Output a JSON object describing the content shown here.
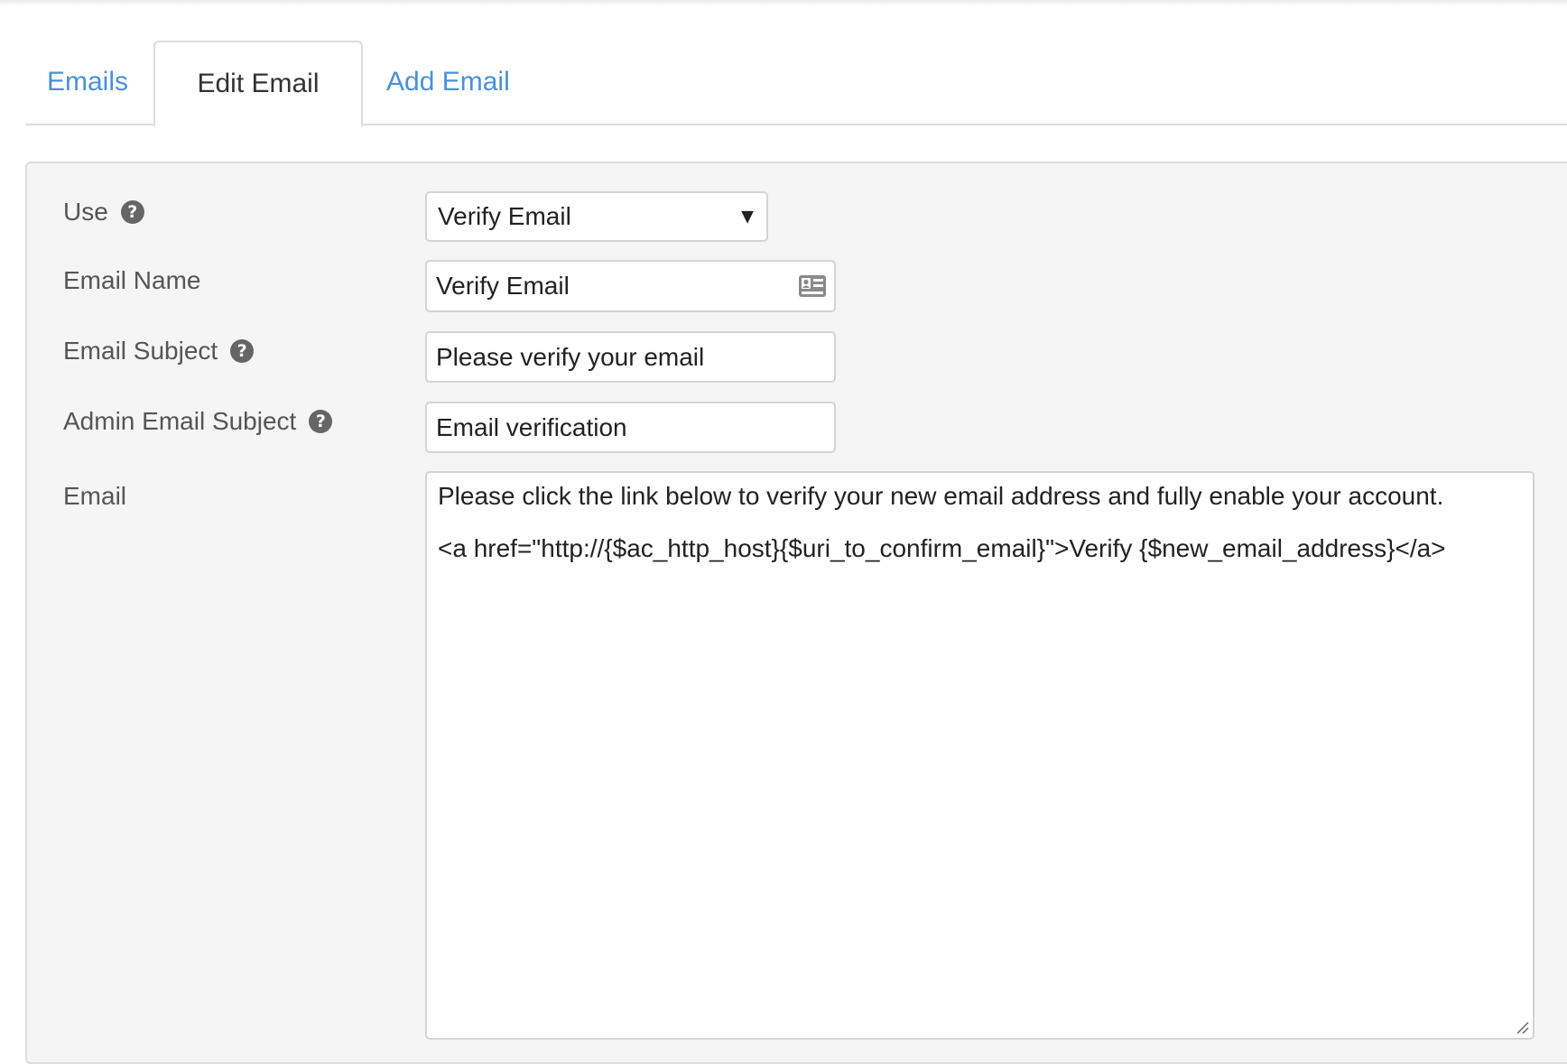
{
  "tabs": {
    "emails": "Emails",
    "edit_email": "Edit Email",
    "add_email": "Add Email"
  },
  "form": {
    "use": {
      "label": "Use",
      "value": "Verify Email"
    },
    "email_name": {
      "label": "Email Name",
      "value": "Verify Email"
    },
    "email_subject": {
      "label": "Email Subject",
      "value": "Please verify your email"
    },
    "admin_email_subject": {
      "label": "Admin Email Subject",
      "value": "Email verification"
    },
    "email": {
      "label": "Email",
      "line1": "Please click the link below to verify your new email address and fully enable your account.",
      "line2": "<a href=\"http://{$ac_http_host}{$uri_to_confirm_email}\">Verify {$new_email_address}</a>"
    }
  },
  "icons": {
    "help": "question-circle-icon",
    "card": "id-card-icon",
    "select_arrow": "caret-down-icon",
    "resize": "resize-handle-icon"
  },
  "colors": {
    "link": "#4a90d9",
    "panel_bg": "#f5f5f5",
    "border": "#dddddd"
  }
}
